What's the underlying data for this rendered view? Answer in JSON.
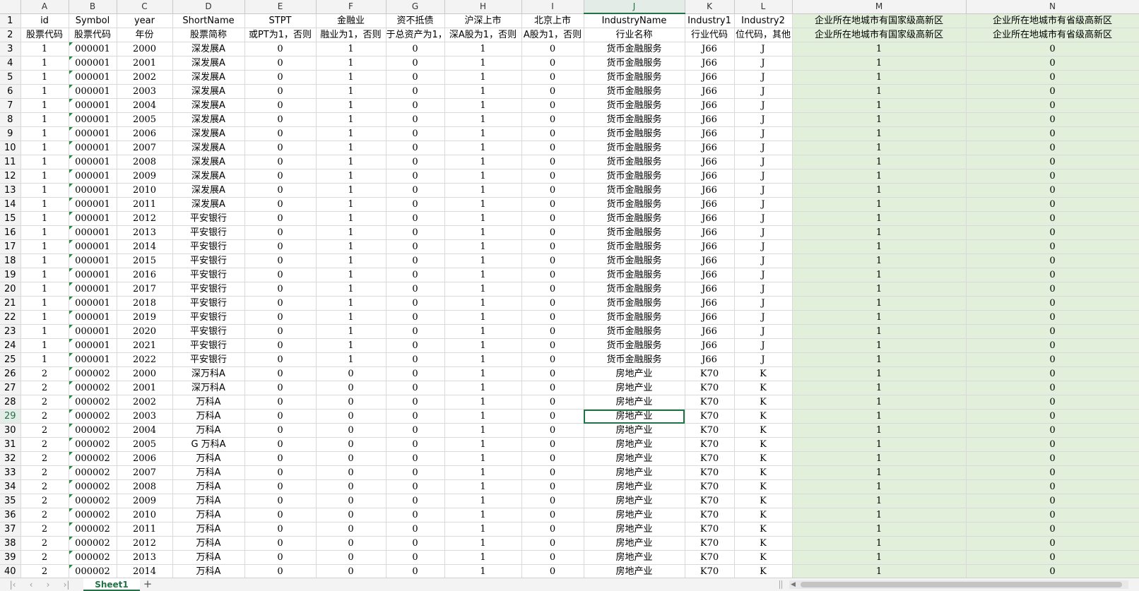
{
  "columns": [
    "A",
    "B",
    "C",
    "D",
    "E",
    "F",
    "G",
    "H",
    "I",
    "J",
    "K",
    "L",
    "M",
    "N"
  ],
  "selected": {
    "column": "J",
    "row": 29
  },
  "header_row1": [
    "id",
    "Symbol",
    "year",
    "ShortName",
    "STPT",
    "金融业",
    "资不抵债",
    "沪深上市",
    "北京上市",
    "IndustryName",
    "Industry1",
    "Industry2",
    "企业所在地城市有国家级高新区",
    "企业所在地城市有省级高新区"
  ],
  "header_row2": [
    "股票代码",
    "股票代码",
    "年份",
    "股票简称",
    "或PT为1，否则",
    "融业为1，否则",
    "于总资产为1，",
    "深A股为1，否则",
    "A股为1，否则",
    "行业名称",
    "行业代码",
    "位代码，其他",
    "企业所在地城市有国家级高新区",
    "企业所在地城市有省级高新区"
  ],
  "rows": [
    [
      "1",
      "000001",
      "2000",
      "深发展A",
      "0",
      "1",
      "0",
      "1",
      "0",
      "货币金融服务",
      "J66",
      "J",
      "1",
      "0"
    ],
    [
      "1",
      "000001",
      "2001",
      "深发展A",
      "0",
      "1",
      "0",
      "1",
      "0",
      "货币金融服务",
      "J66",
      "J",
      "1",
      "0"
    ],
    [
      "1",
      "000001",
      "2002",
      "深发展A",
      "0",
      "1",
      "0",
      "1",
      "0",
      "货币金融服务",
      "J66",
      "J",
      "1",
      "0"
    ],
    [
      "1",
      "000001",
      "2003",
      "深发展A",
      "0",
      "1",
      "0",
      "1",
      "0",
      "货币金融服务",
      "J66",
      "J",
      "1",
      "0"
    ],
    [
      "1",
      "000001",
      "2004",
      "深发展A",
      "0",
      "1",
      "0",
      "1",
      "0",
      "货币金融服务",
      "J66",
      "J",
      "1",
      "0"
    ],
    [
      "1",
      "000001",
      "2005",
      "深发展A",
      "0",
      "1",
      "0",
      "1",
      "0",
      "货币金融服务",
      "J66",
      "J",
      "1",
      "0"
    ],
    [
      "1",
      "000001",
      "2006",
      "深发展A",
      "0",
      "1",
      "0",
      "1",
      "0",
      "货币金融服务",
      "J66",
      "J",
      "1",
      "0"
    ],
    [
      "1",
      "000001",
      "2007",
      "深发展A",
      "0",
      "1",
      "0",
      "1",
      "0",
      "货币金融服务",
      "J66",
      "J",
      "1",
      "0"
    ],
    [
      "1",
      "000001",
      "2008",
      "深发展A",
      "0",
      "1",
      "0",
      "1",
      "0",
      "货币金融服务",
      "J66",
      "J",
      "1",
      "0"
    ],
    [
      "1",
      "000001",
      "2009",
      "深发展A",
      "0",
      "1",
      "0",
      "1",
      "0",
      "货币金融服务",
      "J66",
      "J",
      "1",
      "0"
    ],
    [
      "1",
      "000001",
      "2010",
      "深发展A",
      "0",
      "1",
      "0",
      "1",
      "0",
      "货币金融服务",
      "J66",
      "J",
      "1",
      "0"
    ],
    [
      "1",
      "000001",
      "2011",
      "深发展A",
      "0",
      "1",
      "0",
      "1",
      "0",
      "货币金融服务",
      "J66",
      "J",
      "1",
      "0"
    ],
    [
      "1",
      "000001",
      "2012",
      "平安银行",
      "0",
      "1",
      "0",
      "1",
      "0",
      "货币金融服务",
      "J66",
      "J",
      "1",
      "0"
    ],
    [
      "1",
      "000001",
      "2013",
      "平安银行",
      "0",
      "1",
      "0",
      "1",
      "0",
      "货币金融服务",
      "J66",
      "J",
      "1",
      "0"
    ],
    [
      "1",
      "000001",
      "2014",
      "平安银行",
      "0",
      "1",
      "0",
      "1",
      "0",
      "货币金融服务",
      "J66",
      "J",
      "1",
      "0"
    ],
    [
      "1",
      "000001",
      "2015",
      "平安银行",
      "0",
      "1",
      "0",
      "1",
      "0",
      "货币金融服务",
      "J66",
      "J",
      "1",
      "0"
    ],
    [
      "1",
      "000001",
      "2016",
      "平安银行",
      "0",
      "1",
      "0",
      "1",
      "0",
      "货币金融服务",
      "J66",
      "J",
      "1",
      "0"
    ],
    [
      "1",
      "000001",
      "2017",
      "平安银行",
      "0",
      "1",
      "0",
      "1",
      "0",
      "货币金融服务",
      "J66",
      "J",
      "1",
      "0"
    ],
    [
      "1",
      "000001",
      "2018",
      "平安银行",
      "0",
      "1",
      "0",
      "1",
      "0",
      "货币金融服务",
      "J66",
      "J",
      "1",
      "0"
    ],
    [
      "1",
      "000001",
      "2019",
      "平安银行",
      "0",
      "1",
      "0",
      "1",
      "0",
      "货币金融服务",
      "J66",
      "J",
      "1",
      "0"
    ],
    [
      "1",
      "000001",
      "2020",
      "平安银行",
      "0",
      "1",
      "0",
      "1",
      "0",
      "货币金融服务",
      "J66",
      "J",
      "1",
      "0"
    ],
    [
      "1",
      "000001",
      "2021",
      "平安银行",
      "0",
      "1",
      "0",
      "1",
      "0",
      "货币金融服务",
      "J66",
      "J",
      "1",
      "0"
    ],
    [
      "1",
      "000001",
      "2022",
      "平安银行",
      "0",
      "1",
      "0",
      "1",
      "0",
      "货币金融服务",
      "J66",
      "J",
      "1",
      "0"
    ],
    [
      "2",
      "000002",
      "2000",
      "深万科A",
      "0",
      "0",
      "0",
      "1",
      "0",
      "房地产业",
      "K70",
      "K",
      "1",
      "0"
    ],
    [
      "2",
      "000002",
      "2001",
      "深万科A",
      "0",
      "0",
      "0",
      "1",
      "0",
      "房地产业",
      "K70",
      "K",
      "1",
      "0"
    ],
    [
      "2",
      "000002",
      "2002",
      "万科A",
      "0",
      "0",
      "0",
      "1",
      "0",
      "房地产业",
      "K70",
      "K",
      "1",
      "0"
    ],
    [
      "2",
      "000002",
      "2003",
      "万科A",
      "0",
      "0",
      "0",
      "1",
      "0",
      "房地产业",
      "K70",
      "K",
      "1",
      "0"
    ],
    [
      "2",
      "000002",
      "2004",
      "万科A",
      "0",
      "0",
      "0",
      "1",
      "0",
      "房地产业",
      "K70",
      "K",
      "1",
      "0"
    ],
    [
      "2",
      "000002",
      "2005",
      "G 万科A",
      "0",
      "0",
      "0",
      "1",
      "0",
      "房地产业",
      "K70",
      "K",
      "1",
      "0"
    ],
    [
      "2",
      "000002",
      "2006",
      "万科A",
      "0",
      "0",
      "0",
      "1",
      "0",
      "房地产业",
      "K70",
      "K",
      "1",
      "0"
    ],
    [
      "2",
      "000002",
      "2007",
      "万科A",
      "0",
      "0",
      "0",
      "1",
      "0",
      "房地产业",
      "K70",
      "K",
      "1",
      "0"
    ],
    [
      "2",
      "000002",
      "2008",
      "万科A",
      "0",
      "0",
      "0",
      "1",
      "0",
      "房地产业",
      "K70",
      "K",
      "1",
      "0"
    ],
    [
      "2",
      "000002",
      "2009",
      "万科A",
      "0",
      "0",
      "0",
      "1",
      "0",
      "房地产业",
      "K70",
      "K",
      "1",
      "0"
    ],
    [
      "2",
      "000002",
      "2010",
      "万科A",
      "0",
      "0",
      "0",
      "1",
      "0",
      "房地产业",
      "K70",
      "K",
      "1",
      "0"
    ],
    [
      "2",
      "000002",
      "2011",
      "万科A",
      "0",
      "0",
      "0",
      "1",
      "0",
      "房地产业",
      "K70",
      "K",
      "1",
      "0"
    ],
    [
      "2",
      "000002",
      "2012",
      "万科A",
      "0",
      "0",
      "0",
      "1",
      "0",
      "房地产业",
      "K70",
      "K",
      "1",
      "0"
    ],
    [
      "2",
      "000002",
      "2013",
      "万科A",
      "0",
      "0",
      "0",
      "1",
      "0",
      "房地产业",
      "K70",
      "K",
      "1",
      "0"
    ],
    [
      "2",
      "000002",
      "2014",
      "万科A",
      "0",
      "0",
      "0",
      "1",
      "0",
      "房地产业",
      "K70",
      "K",
      "1",
      "0"
    ]
  ],
  "sheet_tabs": [
    "Sheet1"
  ],
  "nav_icons": [
    "first-sheet-icon",
    "prev-sheet-icon",
    "next-sheet-icon",
    "last-sheet-icon"
  ],
  "add_sheet_label": "+",
  "colors": {
    "accent": "#217346",
    "highlight_fill": "#e2efda"
  }
}
